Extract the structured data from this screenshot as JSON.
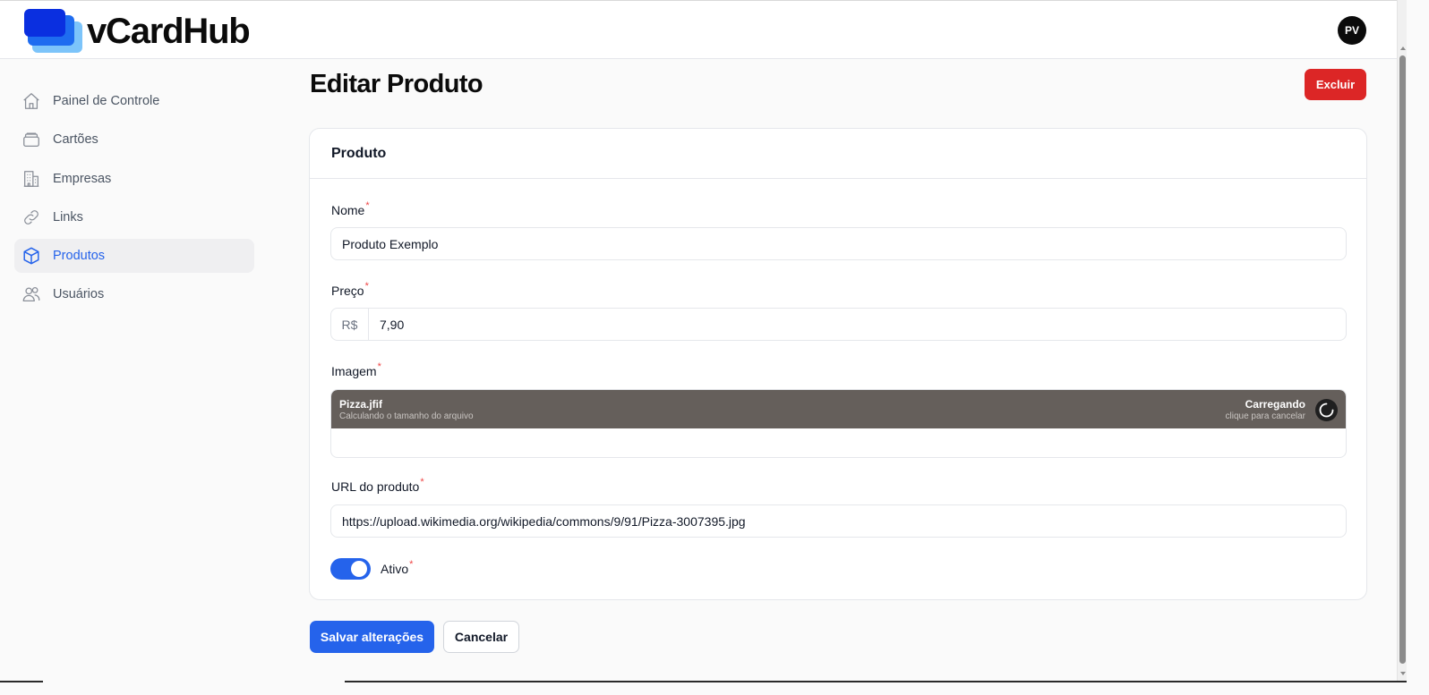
{
  "app": {
    "name": "vCardHub"
  },
  "user": {
    "initials": "PV"
  },
  "sidebar": {
    "items": [
      {
        "label": "Painel de Controle",
        "icon": "home-icon",
        "active": false
      },
      {
        "label": "Cartões",
        "icon": "cards-icon",
        "active": false
      },
      {
        "label": "Empresas",
        "icon": "building-icon",
        "active": false
      },
      {
        "label": "Links",
        "icon": "link-icon",
        "active": false
      },
      {
        "label": "Produtos",
        "icon": "cube-icon",
        "active": true
      },
      {
        "label": "Usuários",
        "icon": "users-icon",
        "active": false
      }
    ]
  },
  "page": {
    "title": "Editar Produto",
    "delete_label": "Excluir"
  },
  "card": {
    "title": "Produto"
  },
  "form": {
    "required_mark": "*",
    "name": {
      "label": "Nome",
      "value": "Produto Exemplo"
    },
    "price": {
      "label": "Preço",
      "prefix": "R$",
      "value": "7,90"
    },
    "image": {
      "label": "Imagem",
      "file_name": "Pizza.jfif",
      "file_status": "Calculando o tamanho do arquivo",
      "upload_status": "Carregando",
      "upload_hint": "clique para cancelar"
    },
    "url": {
      "label": "URL do produto",
      "value": "https://upload.wikimedia.org/wikipedia/commons/9/91/Pizza-3007395.jpg"
    },
    "active": {
      "label": "Ativo",
      "checked": true
    }
  },
  "actions": {
    "save_label": "Salvar alterações",
    "cancel_label": "Cancelar"
  },
  "colors": {
    "accent": "#2563eb",
    "danger": "#dc2626",
    "upload_bar": "#655f5b",
    "logo_dark": "#0a2fe0",
    "logo_mid": "#1e6cf0",
    "logo_light": "#7cc4fa"
  }
}
